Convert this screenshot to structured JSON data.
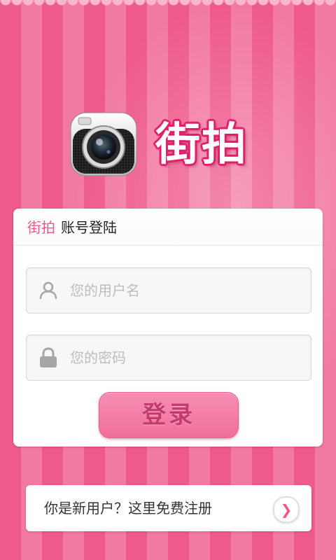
{
  "header": {
    "app_name": "街拍",
    "logo_icon": "camera-icon"
  },
  "login_card": {
    "title_accent": "街拍",
    "title_rest": "账号登陆",
    "username": {
      "placeholder": "您的用户名",
      "value": "",
      "icon": "user-icon"
    },
    "password": {
      "placeholder": "您的密码",
      "value": "",
      "icon": "lock-icon"
    },
    "login_label": "登录"
  },
  "register": {
    "label": "你是新用户？这里免费注册",
    "arrow_glyph": "❯",
    "arrow_icon": "chevron-right-icon"
  },
  "colors": {
    "stripe_dark": "#ee5a8c",
    "stripe_light": "#f27aa2",
    "accent": "#f0568a",
    "button": "#f27aa2",
    "button_text": "#c23c6b"
  }
}
